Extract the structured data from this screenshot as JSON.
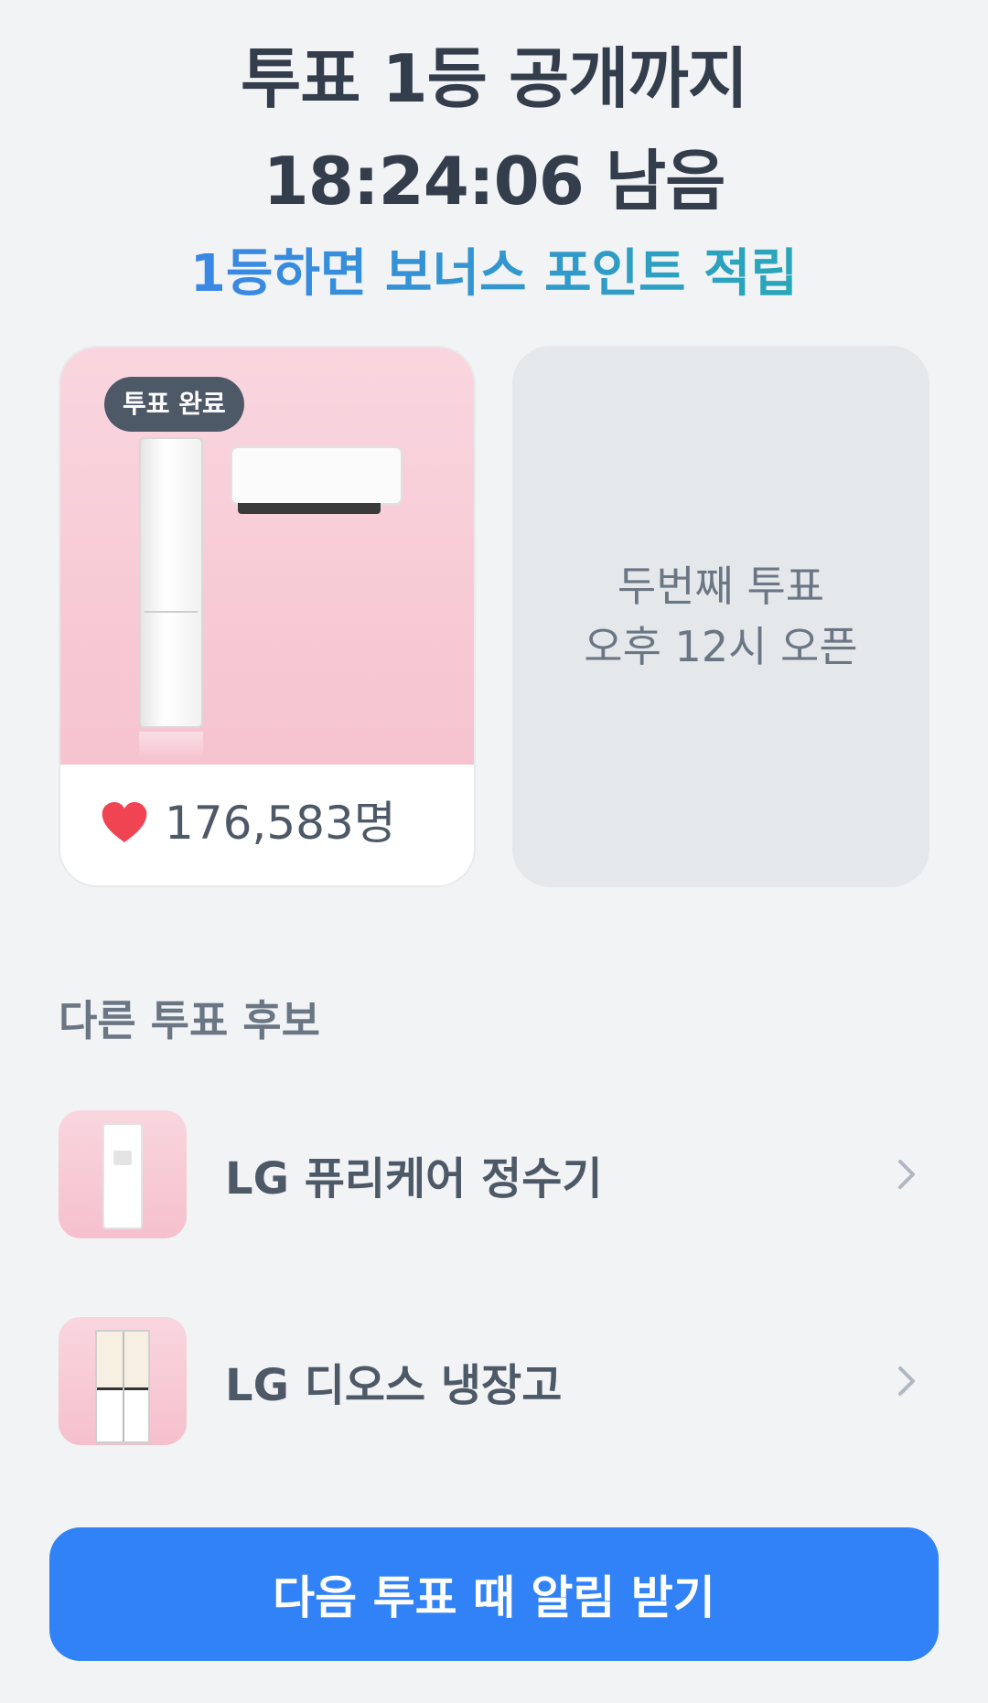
{
  "header": {
    "title_line1": "투표 1등 공개까지",
    "title_line2": "18:24:06 남음",
    "subtitle": "1등하면 보너스 포인트 적립"
  },
  "vote_card": {
    "badge": "투표 완료",
    "likes": "176,583명",
    "icon": "heart-icon",
    "heart_color": "#f04452"
  },
  "next_vote_card": {
    "line1": "두번째 투표",
    "line2": "오후 12시 오픈"
  },
  "other_candidates": {
    "title": "다른 투표 후보",
    "items": [
      {
        "name": "LG 퓨리케어 정수기",
        "icon": "chevron-right-icon"
      },
      {
        "name": "LG 디오스 냉장고",
        "icon": "chevron-right-icon"
      }
    ]
  },
  "cta": {
    "label": "다음 투표 때 알림 받기",
    "color": "#3182f6"
  }
}
